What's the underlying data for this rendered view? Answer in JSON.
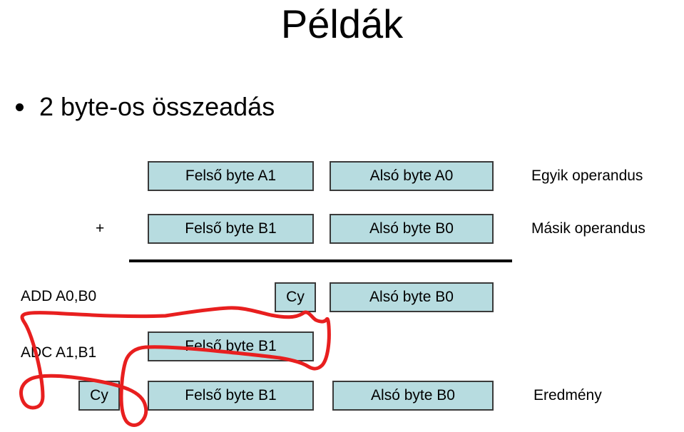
{
  "slide": {
    "title": "Példák",
    "bullet": {
      "marker": "bullet-dot",
      "text": "2 byte-os összeadás"
    }
  },
  "diagram": {
    "operator_plus": "+",
    "rows": [
      {
        "row_name": "operand-a",
        "label": "Egyik operandus",
        "boxes": [
          {
            "name": "felso-byte-a1",
            "text": "Felső byte A1"
          },
          {
            "name": "also-byte-a0",
            "text": "Alsó byte A0"
          }
        ]
      },
      {
        "row_name": "operand-b",
        "label": "Másik operandus",
        "boxes": [
          {
            "name": "felso-byte-b1",
            "text": "Felső byte B1"
          },
          {
            "name": "also-byte-b0",
            "text": "Alsó byte B0"
          }
        ]
      },
      {
        "row_name": "add-step",
        "instruction": "ADD A0,B0",
        "boxes": [
          {
            "name": "carry-flag",
            "text": "Cy"
          },
          {
            "name": "also-byte-b0-result",
            "text": "Alsó byte B0"
          }
        ]
      },
      {
        "row_name": "adc-step",
        "instruction": "ADC A1,B1",
        "boxes": [
          {
            "name": "felso-byte-b1-result",
            "text": "Felső byte B1"
          }
        ]
      },
      {
        "row_name": "final-result",
        "label": "Eredmény",
        "boxes": [
          {
            "name": "carry-flag-final",
            "text": "Cy"
          },
          {
            "name": "felso-byte-b1-final",
            "text": "Felső byte B1"
          },
          {
            "name": "also-byte-b0-final",
            "text": "Alsó byte B0"
          }
        ]
      }
    ],
    "annotation": {
      "name": "red-lasso-highlight",
      "color": "#e81f1f"
    }
  },
  "colors": {
    "box_fill": "#b7dce0",
    "box_border": "#3a3a3a",
    "text": "#000000",
    "background": "#ffffff",
    "annotation_red": "#e81f1f"
  }
}
